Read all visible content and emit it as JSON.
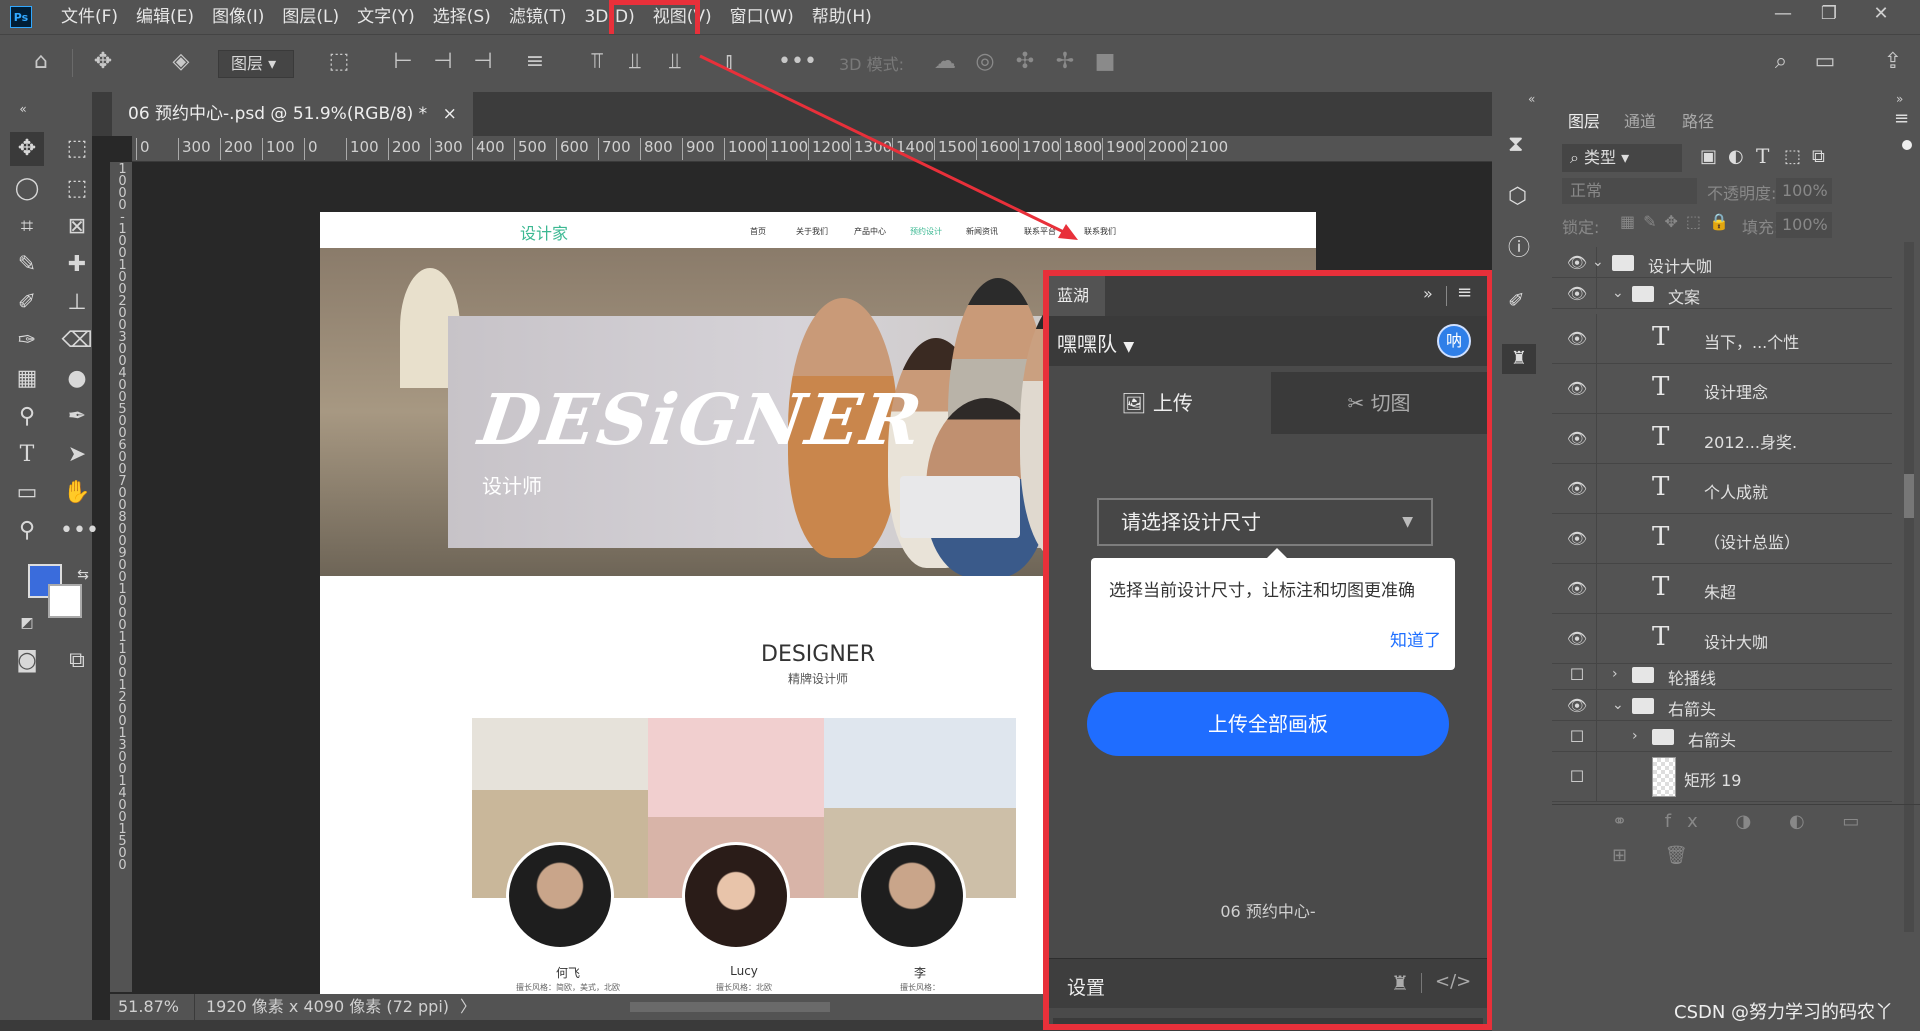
{
  "app": {
    "logo": "Ps"
  },
  "menu": [
    "文件(F)",
    "编辑(E)",
    "图像(I)",
    "图层(L)",
    "文字(Y)",
    "选择(S)",
    "滤镜(T)",
    "3D(D)",
    "视图(V)",
    "窗口(W)",
    "帮助(H)"
  ],
  "options_bar": {
    "layer_select": "图层",
    "mode_3d": "3D 模式:"
  },
  "document": {
    "tab_title": "06 预约中心-.psd @ 51.9%(RGB/8) *",
    "close": "×"
  },
  "ruler": {
    "h_ticks": [
      "0",
      "300",
      "200",
      "100",
      "0",
      "100",
      "200",
      "300",
      "400",
      "500",
      "600",
      "700",
      "800",
      "900",
      "1000",
      "1100",
      "1200",
      "1300",
      "1400",
      "1500",
      "1600",
      "1700",
      "1800",
      "1900",
      "2000",
      "2100"
    ],
    "v_text": "1000-100100200300400500600700800900100011001200130014001500"
  },
  "artboard": {
    "logo": "设计家",
    "nav": [
      "首页",
      "关于我们",
      "产品中心",
      "预约设计",
      "新闻资讯",
      "联系平台",
      "联系我们"
    ],
    "hero_title": "DESiGNER",
    "hero_sub": "设计师",
    "section_title": "DESIGNER",
    "section_sub": "精牌设计师",
    "cards": [
      {
        "name": "何飞",
        "desc": "擅长风格：简欧，美式，北欧"
      },
      {
        "name": "Lucy",
        "desc": "擅长风格：北欧"
      },
      {
        "name": "李",
        "desc": "擅长风格："
      }
    ]
  },
  "status": {
    "zoom": "51.87%",
    "size": "1920 像素 x 4090 像素 (72 ppi)",
    "arrow": "〉"
  },
  "plugin": {
    "tab": "蓝湖",
    "team": "嘿嘿队",
    "team_avatar": "呐",
    "tabs": [
      {
        "label": "上传"
      },
      {
        "label": "切图"
      }
    ],
    "select_placeholder": "请选择设计尺寸",
    "tip_text": "选择当前设计尺寸，让标注和切图更准确",
    "tip_ok": "知道了",
    "upload_all": "上传全部画板",
    "doc_name": "06 预约中心-",
    "settings": "设置"
  },
  "layers_panel": {
    "tabs": [
      "图层",
      "通道",
      "路径"
    ],
    "filter": "类型",
    "blend": "正常",
    "opacity_label": "不透明度:",
    "opacity": "100%",
    "lock_label": "锁定:",
    "fill_label": "填充:",
    "fill": "100%",
    "rows": [
      {
        "name": "设计大咖",
        "kind": "group-open"
      },
      {
        "name": "文案",
        "kind": "group-open"
      },
      {
        "name": "当下，...个性",
        "kind": "text"
      },
      {
        "name": "设计理念",
        "kind": "text"
      },
      {
        "name": "2012...身奖.",
        "kind": "text"
      },
      {
        "name": "个人成就",
        "kind": "text"
      },
      {
        "name": "（设计总监）",
        "kind": "text"
      },
      {
        "name": "朱超",
        "kind": "text"
      },
      {
        "name": "设计大咖",
        "kind": "text"
      },
      {
        "name": "轮播线",
        "kind": "group"
      },
      {
        "name": "右箭头",
        "kind": "group-open"
      },
      {
        "name": "右箭头",
        "kind": "group"
      },
      {
        "name": "矩形 19",
        "kind": "shape"
      }
    ]
  },
  "watermark": "CSDN @努力学习的码农丫",
  "colors": {
    "highlight": "#e8303a",
    "accent_blue": "#1f6dff",
    "ps_panel": "#535353"
  }
}
